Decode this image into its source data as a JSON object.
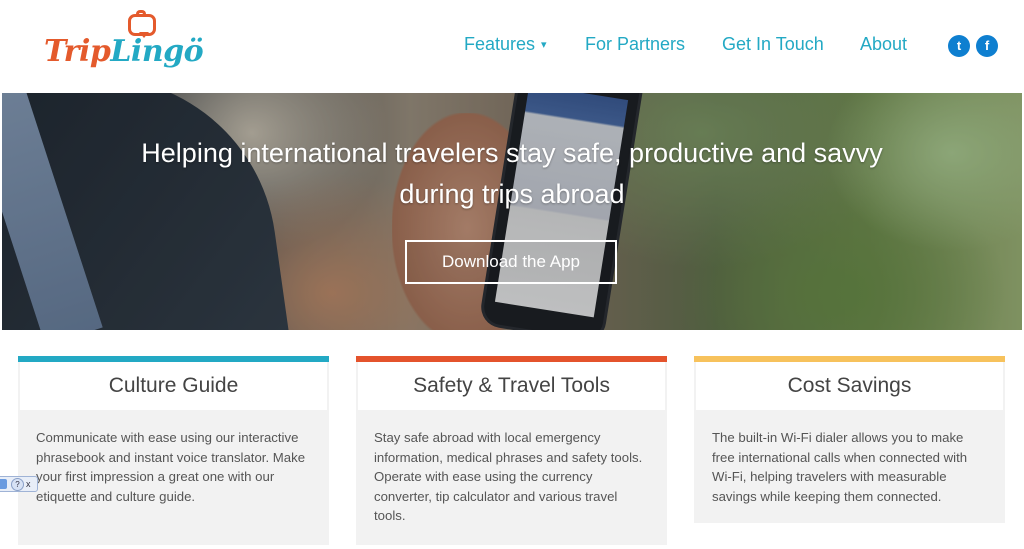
{
  "brand": {
    "part1": "Trip",
    "part2": "Lingö"
  },
  "nav": {
    "items": [
      {
        "label": "Features",
        "has_dropdown": true
      },
      {
        "label": "For Partners"
      },
      {
        "label": "Get In Touch"
      },
      {
        "label": "About"
      }
    ],
    "dropdown_caret": "▾",
    "social": {
      "twitter_glyph": "t",
      "facebook_glyph": "f"
    }
  },
  "hero": {
    "title": "Helping international travelers stay safe, productive and savvy during trips abroad",
    "cta": "Download the App"
  },
  "cards": [
    {
      "title": "Culture Guide",
      "accent": "#23a9c4",
      "text": "Communicate with ease using our interactive phrasebook and instant voice translator. Make your first impression a great one with our etiquette and culture guide."
    },
    {
      "title": "Safety & Travel Tools",
      "accent": "#e4532c",
      "text": "Stay safe abroad with local emergency information, medical phrases and safety tools. Operate with ease using the currency converter, tip calculator and various travel tools."
    },
    {
      "title": "Cost Savings",
      "accent": "#f7c25c",
      "text": "The built-in Wi-Fi dialer allows you to make free international calls when connected with Wi-Fi, helping travelers with measurable savings while keeping them connected."
    }
  ],
  "edge_widget": {
    "help": "?",
    "close": "x"
  },
  "colors": {
    "brand_orange": "#e45a2c",
    "brand_teal": "#23a9c4",
    "social_blue": "#0e7fd0"
  }
}
